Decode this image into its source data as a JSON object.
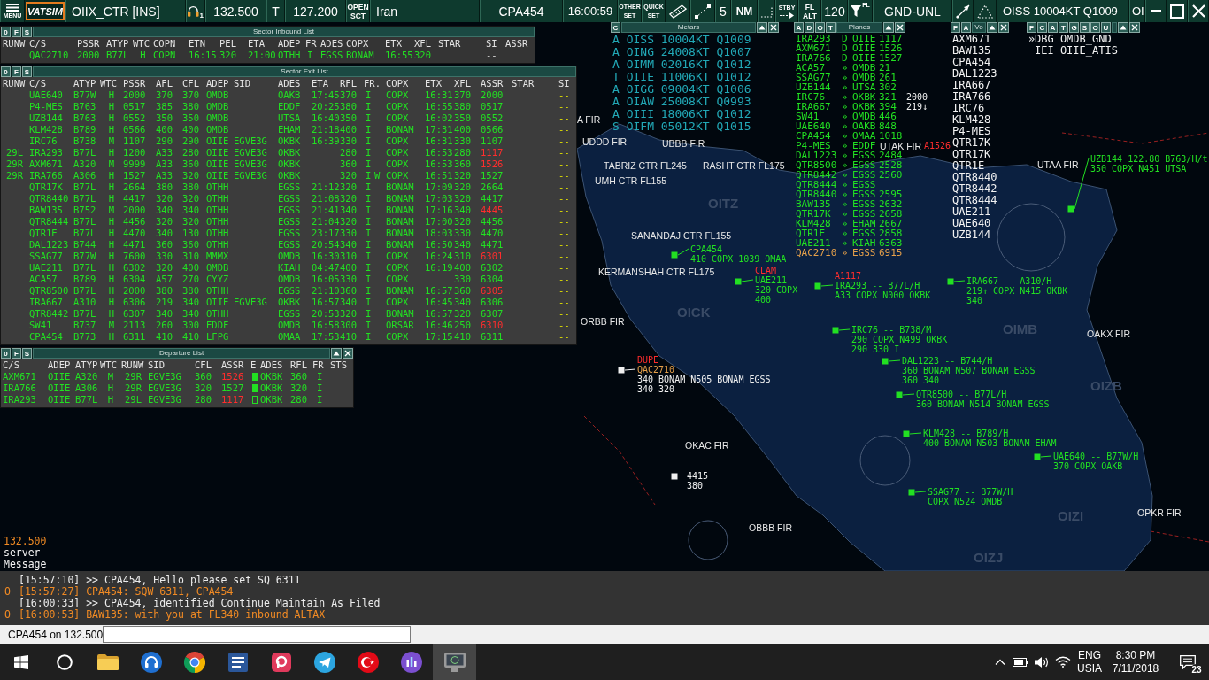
{
  "toolbar": {
    "menu_label": "MENU",
    "logo": "VATSIM",
    "position": "OIIX_CTR [INS]",
    "headset_count": "1",
    "primary_frequency": "132.500",
    "atis_letter": "T",
    "secondary_frequency": "127.200",
    "open_sector": [
      "OPEN",
      "SCT"
    ],
    "sector_file": "Iran",
    "selected_aircraft": "CPA454",
    "clock": "16:00:59",
    "other_set": [
      "OTHER",
      "SET"
    ],
    "quick_set": [
      "QUICK",
      "SET"
    ],
    "range": "5",
    "unit": "NM",
    "standby": "STBY",
    "altitude_mode": [
      "FL",
      "ALT"
    ],
    "transition_level": "120",
    "filter_label": "FL",
    "altitude_filter": "GND-UNL",
    "metar": "OISS 10004KT Q1009",
    "metar_cut": "OI"
  },
  "inbound_list": {
    "title": "Sector Inbound List",
    "buttons": [
      "0",
      "F",
      "S"
    ],
    "columns": [
      "RUNW",
      "C/S",
      "PSSR",
      "ATYP",
      "WTC",
      "COPN",
      "ETN",
      "PEL",
      "ETA",
      "ADEP",
      "FR",
      "ADES",
      "COPX",
      "ETX",
      "XFL",
      "STAR",
      "SI",
      "ASSR"
    ],
    "rows": [
      {
        "cs": "QAC2710",
        "pssr": "2000",
        "atyp": "B77L",
        "wtc": "H",
        "copn": "COPN",
        "etn": "16:15",
        "pel": "320",
        "eta": "21:00",
        "adep": "OTHH",
        "fr": "I",
        "ades": "EGSS",
        "copx": "BONAM",
        "etx": "16:55",
        "xfl": "320",
        "si": "--"
      }
    ]
  },
  "exit_list": {
    "title": "Sector Exit List",
    "buttons": [
      "0",
      "F",
      "S"
    ],
    "columns": [
      "RUNW",
      "C/S",
      "ATYP",
      "WTC",
      "PSSR",
      "AFL",
      "CFL",
      "ADEP",
      "SID",
      "ADES",
      "ETA",
      "RFL",
      "FR.",
      "COPX",
      "ETX",
      "XFL",
      "ASSR",
      "STAR",
      "SI"
    ],
    "rows": [
      {
        "cs": "UAE640",
        "atyp": "B77W",
        "wtc": "H",
        "pssr": "2000",
        "afl": "370",
        "cfl": "370",
        "adep": "OMDB",
        "ades": "OAKB",
        "eta": "17:45",
        "rfl": "370",
        "fr": "I",
        "copx": "COPX",
        "etx": "16:31",
        "xfl": "370",
        "assr": "2000",
        "assr_mismatch": false,
        "si": "--"
      },
      {
        "cs": "P4-MES",
        "atyp": "B763",
        "wtc": "H",
        "pssr": "0517",
        "afl": "385",
        "cfl": "380",
        "adep": "OMDB",
        "ades": "EDDF",
        "eta": "20:25",
        "rfl": "380",
        "fr": "I",
        "copx": "COPX",
        "etx": "16:55",
        "xfl": "380",
        "assr": "0517",
        "assr_mismatch": false,
        "si": "--"
      },
      {
        "cs": "UZB144",
        "atyp": "B763",
        "wtc": "H",
        "pssr": "0552",
        "afl": "350",
        "cfl": "350",
        "adep": "OMDB",
        "ades": "UTSA",
        "eta": "16:40",
        "rfl": "350",
        "fr": "I",
        "copx": "COPX",
        "etx": "16:02",
        "xfl": "350",
        "assr": "0552",
        "assr_mismatch": false,
        "si": "--"
      },
      {
        "cs": "KLM428",
        "atyp": "B789",
        "wtc": "H",
        "pssr": "0566",
        "afl": "400",
        "cfl": "400",
        "adep": "OMDB",
        "ades": "EHAM",
        "eta": "21:18",
        "rfl": "400",
        "fr": "I",
        "copx": "BONAM",
        "etx": "17:31",
        "xfl": "400",
        "assr": "0566",
        "assr_mismatch": false,
        "si": "--"
      },
      {
        "cs": "IRC76",
        "atyp": "B738",
        "wtc": "M",
        "pssr": "1107",
        "afl": "290",
        "cfl": "290",
        "adep": "OIIE",
        "sid": "EGVE3G",
        "ades": "OKBK",
        "eta": "16:39",
        "rfl": "330",
        "fr": "I",
        "copx": "COPX",
        "etx": "16:31",
        "xfl": "330",
        "assr": "1107",
        "assr_mismatch": false,
        "si": "--"
      },
      {
        "runw": "29L",
        "cs": "IRA293",
        "atyp": "B77L",
        "wtc": "H",
        "pssr": "1200",
        "afl": "A33",
        "cfl": "280",
        "adep": "OIIE",
        "sid": "EGVE3G",
        "ades": "OKBK",
        "rfl": "280",
        "fr": "I",
        "copx": "COPX",
        "etx": "16:53",
        "xfl": "280",
        "assr": "1117",
        "assr_mismatch": true,
        "si": "--"
      },
      {
        "runw": "29R",
        "cs": "AXM671",
        "atyp": "A320",
        "wtc": "M",
        "pssr": "9999",
        "afl": "A33",
        "cfl": "360",
        "adep": "OIIE",
        "sid": "EGVE3G",
        "ades": "OKBK",
        "rfl": "360",
        "fr": "I",
        "copx": "COPX",
        "etx": "16:53",
        "xfl": "360",
        "assr": "1526",
        "assr_mismatch": true,
        "si": "--"
      },
      {
        "runw": "29R",
        "cs": "IRA766",
        "atyp": "A306",
        "wtc": "H",
        "pssr": "1527",
        "afl": "A33",
        "cfl": "320",
        "adep": "OIIE",
        "sid": "EGVE3G",
        "ades": "OKBK",
        "rfl": "320",
        "fr": "I",
        "flag": "W",
        "copx": "COPX",
        "etx": "16:51",
        "xfl": "320",
        "assr": "1527",
        "assr_mismatch": false,
        "si": "--"
      },
      {
        "cs": "QTR17K",
        "atyp": "B77L",
        "wtc": "H",
        "pssr": "2664",
        "afl": "380",
        "cfl": "380",
        "adep": "OTHH",
        "ades": "EGSS",
        "eta": "21:12",
        "rfl": "320",
        "fr": "I",
        "copx": "BONAM",
        "etx": "17:09",
        "xfl": "320",
        "assr": "2664",
        "assr_mismatch": false,
        "si": "--"
      },
      {
        "cs": "QTR8440",
        "atyp": "B77L",
        "wtc": "H",
        "pssr": "4417",
        "afl": "320",
        "cfl": "320",
        "adep": "OTHH",
        "ades": "EGSS",
        "eta": "21:08",
        "rfl": "320",
        "fr": "I",
        "copx": "BONAM",
        "etx": "17:03",
        "xfl": "320",
        "assr": "4417",
        "assr_mismatch": false,
        "si": "--"
      },
      {
        "cs": "BAW135",
        "atyp": "B752",
        "wtc": "M",
        "pssr": "2000",
        "afl": "340",
        "cfl": "340",
        "adep": "OTHH",
        "ades": "EGSS",
        "eta": "21:41",
        "rfl": "340",
        "fr": "I",
        "copx": "BONAM",
        "etx": "17:16",
        "xfl": "340",
        "assr": "4445",
        "assr_mismatch": true,
        "si": "--"
      },
      {
        "cs": "QTR8444",
        "atyp": "B77L",
        "wtc": "H",
        "pssr": "4456",
        "afl": "320",
        "cfl": "320",
        "adep": "OTHH",
        "ades": "EGSS",
        "eta": "21:04",
        "rfl": "320",
        "fr": "I",
        "copx": "BONAM",
        "etx": "17:00",
        "xfl": "320",
        "assr": "4456",
        "assr_mismatch": false,
        "si": "--"
      },
      {
        "cs": "QTR1E",
        "atyp": "B77L",
        "wtc": "H",
        "pssr": "4470",
        "afl": "340",
        "cfl": "130",
        "adep": "OTHH",
        "ades": "EGSS",
        "eta": "23:17",
        "rfl": "330",
        "fr": "I",
        "copx": "BONAM",
        "etx": "18:03",
        "xfl": "330",
        "assr": "4470",
        "assr_mismatch": false,
        "si": "--"
      },
      {
        "cs": "DAL1223",
        "atyp": "B744",
        "wtc": "H",
        "pssr": "4471",
        "afl": "360",
        "cfl": "360",
        "adep": "OTHH",
        "ades": "EGSS",
        "eta": "20:54",
        "rfl": "340",
        "fr": "I",
        "copx": "BONAM",
        "etx": "16:50",
        "xfl": "340",
        "assr": "4471",
        "assr_mismatch": false,
        "si": "--"
      },
      {
        "cs": "SSAG77",
        "atyp": "B77W",
        "wtc": "H",
        "pssr": "7600",
        "afl": "330",
        "cfl": "310",
        "adep": "MMMX",
        "ades": "OMDB",
        "eta": "16:30",
        "rfl": "310",
        "fr": "I",
        "copx": "COPX",
        "etx": "16:24",
        "xfl": "310",
        "assr": "6301",
        "assr_mismatch": true,
        "si": "--"
      },
      {
        "cs": "UAE211",
        "atyp": "B77L",
        "wtc": "H",
        "pssr": "6302",
        "afl": "320",
        "cfl": "400",
        "adep": "OMDB",
        "ades": "KIAH",
        "eta": "04:47",
        "rfl": "400",
        "fr": "I",
        "copx": "COPX",
        "etx": "16:19",
        "xfl": "400",
        "assr": "6302",
        "assr_mismatch": false,
        "si": "--"
      },
      {
        "cs": "ACA57",
        "atyp": "B789",
        "wtc": "H",
        "pssr": "6304",
        "afl": "A57",
        "cfl": "270",
        "adep": "CYYZ",
        "ades": "OMDB",
        "eta": "16:05",
        "rfl": "330",
        "fr": "I",
        "copx": "COPX",
        "xfl": "330",
        "assr": "6304",
        "assr_mismatch": false,
        "si": "--"
      },
      {
        "cs": "QTR8500",
        "atyp": "B77L",
        "wtc": "H",
        "pssr": "2000",
        "afl": "380",
        "cfl": "380",
        "adep": "OTHH",
        "ades": "EGSS",
        "eta": "21:10",
        "rfl": "360",
        "fr": "I",
        "copx": "BONAM",
        "etx": "16:57",
        "xfl": "360",
        "assr": "6305",
        "assr_mismatch": true,
        "si": "--"
      },
      {
        "cs": "IRA667",
        "atyp": "A310",
        "wtc": "H",
        "pssr": "6306",
        "afl": "219",
        "cfl": "340",
        "adep": "OIIE",
        "sid": "EGVE3G",
        "ades": "OKBK",
        "eta": "16:57",
        "rfl": "340",
        "fr": "I",
        "copx": "COPX",
        "etx": "16:45",
        "xfl": "340",
        "assr": "6306",
        "assr_mismatch": false,
        "si": "--"
      },
      {
        "cs": "QTR8442",
        "atyp": "B77L",
        "wtc": "H",
        "pssr": "6307",
        "afl": "340",
        "cfl": "340",
        "adep": "OTHH",
        "ades": "EGSS",
        "eta": "20:53",
        "rfl": "320",
        "fr": "I",
        "copx": "BONAM",
        "etx": "16:57",
        "xfl": "320",
        "assr": "6307",
        "assr_mismatch": false,
        "si": "--"
      },
      {
        "cs": "SW41",
        "atyp": "B737",
        "wtc": "M",
        "pssr": "2113",
        "afl": "260",
        "cfl": "300",
        "adep": "EDDF",
        "ades": "OMDB",
        "eta": "16:58",
        "rfl": "300",
        "fr": "I",
        "copx": "ORSAR",
        "etx": "16:46",
        "xfl": "250",
        "assr": "6310",
        "assr_mismatch": true,
        "si": "--"
      },
      {
        "cs": "CPA454",
        "atyp": "B773",
        "wtc": "H",
        "pssr": "6311",
        "afl": "410",
        "cfl": "410",
        "adep": "LFPG",
        "ades": "OMAA",
        "eta": "17:53",
        "rfl": "410",
        "fr": "I",
        "copx": "COPX",
        "etx": "17:15",
        "xfl": "410",
        "assr": "6311",
        "assr_mismatch": false,
        "si": "--"
      }
    ]
  },
  "departure_list": {
    "title": "Departure List",
    "buttons": [
      "0",
      "F",
      "S"
    ],
    "columns": [
      "C/S",
      "ADEP",
      "ATYP",
      "WTC",
      "RUNW",
      "SID",
      "CFL",
      "ASSR",
      "E",
      "ADES",
      "RFL",
      "FR",
      "STS"
    ],
    "rows": [
      {
        "cs": "AXM671",
        "adep": "OIIE",
        "atyp": "A320",
        "wtc": "M",
        "runw": "29R",
        "sid": "EGVE3G",
        "cfl": "360",
        "assr": "1526",
        "assr_mismatch": true,
        "e_flag": true,
        "ades": "OKBK",
        "rfl": "360",
        "fr": "I"
      },
      {
        "cs": "IRA766",
        "adep": "OIIE",
        "atyp": "A306",
        "wtc": "H",
        "runw": "29R",
        "sid": "EGVE3G",
        "cfl": "320",
        "assr": "1527",
        "assr_mismatch": false,
        "e_flag": true,
        "ades": "OKBK",
        "rfl": "320",
        "fr": "I"
      },
      {
        "cs": "IRA293",
        "adep": "OIIE",
        "atyp": "B77L",
        "wtc": "H",
        "runw": "29L",
        "sid": "EGVE3G",
        "cfl": "280",
        "assr": "1117",
        "assr_mismatch": true,
        "e_flag": false,
        "ades": "OKBK",
        "rfl": "280",
        "fr": "I"
      }
    ]
  },
  "metars": {
    "buttons": [
      "C"
    ],
    "title": "Metars",
    "lines": [
      "A OISS 10004KT Q1009",
      "A OING 24008KT Q1007",
      "A OIMM 02016KT Q1012",
      "T OIIE 11006KT Q1012",
      "A OIGG 09004KT Q1006",
      "A OIAW 25008KT Q0993",
      "A OIII 18006KT Q1012",
      "S OIFM 05012KT Q1015"
    ]
  },
  "planes": {
    "buttons": [
      "A",
      "D",
      "O",
      "T"
    ],
    "title": "Planes",
    "rows": [
      {
        "callsign": "IRA293",
        "marker": "D",
        "airport": "OIIE",
        "value": "1117",
        "color": "#22e022"
      },
      {
        "callsign": "AXM671",
        "marker": "D",
        "airport": "OIIE",
        "value": "1526",
        "color": "#22e022"
      },
      {
        "callsign": "IRA766",
        "marker": "D",
        "airport": "OIIE",
        "value": "1527",
        "color": "#22e022"
      },
      {
        "callsign": "ACA57",
        "marker": "»",
        "airport": "OMDB",
        "value": "21",
        "color": "#22e022"
      },
      {
        "callsign": "SSAG77",
        "marker": "»",
        "airport": "OMDB",
        "value": "261",
        "color": "#22e022"
      },
      {
        "callsign": "UZB144",
        "marker": "»",
        "airport": "UTSA",
        "value": "302",
        "color": "#22e022"
      },
      {
        "callsign": "IRC76",
        "marker": "»",
        "airport": "OKBK",
        "value": "321",
        "color": "#22e022"
      },
      {
        "callsign": "IRA667",
        "marker": "»",
        "airport": "OKBK",
        "value": "394",
        "color": "#22e022"
      },
      {
        "callsign": "SW41",
        "marker": "»",
        "airport": "OMDB",
        "value": "446",
        "color": "#22e022"
      },
      {
        "callsign": "UAE640",
        "marker": "»",
        "airport": "OAKB",
        "value": "848",
        "color": "#22e022"
      },
      {
        "callsign": "CPA454",
        "marker": "»",
        "airport": "OMAA",
        "value": "1018",
        "color": "#22e022"
      },
      {
        "callsign": "P4-MES",
        "marker": "»",
        "airport": "EDDF",
        "color": "#22e022"
      },
      {
        "callsign": "DAL1223",
        "marker": "»",
        "airport": "EGSS",
        "value": "2484",
        "color": "#22e022"
      },
      {
        "callsign": "QTR8500",
        "marker": "»",
        "airport": "EGSS",
        "value": "2528",
        "color": "#22e022"
      },
      {
        "callsign": "QTR8442",
        "marker": "»",
        "airport": "EGSS",
        "value": "2560",
        "color": "#22e022"
      },
      {
        "callsign": "QTR8444",
        "marker": "»",
        "airport": "EGSS",
        "color": "#22e022"
      },
      {
        "callsign": "QTR8440",
        "marker": "»",
        "airport": "EGSS",
        "value": "2595",
        "color": "#22e022"
      },
      {
        "callsign": "BAW135",
        "marker": "»",
        "airport": "EGSS",
        "value": "2632",
        "color": "#22e022"
      },
      {
        "callsign": "QTR17K",
        "marker": "»",
        "airport": "EGSS",
        "value": "2658",
        "color": "#22e022"
      },
      {
        "callsign": "KLM428",
        "marker": "»",
        "airport": "EHAM",
        "value": "2667",
        "color": "#22e022"
      },
      {
        "callsign": "QTR1E",
        "marker": "»",
        "airport": "EGSS",
        "value": "2858",
        "color": "#22e022"
      },
      {
        "callsign": "UAE211",
        "marker": "»",
        "airport": "KIAH",
        "value": "6363",
        "color": "#22e022"
      },
      {
        "callsign": "QAC2710",
        "marker": "»",
        "airport": "EGSS",
        "value": "6915",
        "color": "#e6a04a"
      }
    ]
  },
  "voice_list": {
    "buttons": [
      "F",
      "A"
    ],
    "title": "Vo",
    "callsigns": [
      "AXM671",
      "BAW135",
      "CPA454",
      "DAL1223",
      "IRA667",
      "IRA766",
      "IRC76",
      "KLM428",
      "P4-MES",
      "QTR17K",
      "QTR17K",
      "QTR1E",
      "QTR8440",
      "QTR8442",
      "QTR8444",
      "UAE211",
      "UAE640",
      "UZB144"
    ]
  },
  "controller_list": {
    "buttons": [
      "F",
      "C",
      "A",
      "T",
      "G",
      "S",
      "O",
      "U"
    ],
    "rows": [
      {
        "marker": "»",
        "text": "DBG OMDB_GND"
      },
      {
        "text": "IEI OIIE_ATIS"
      }
    ]
  },
  "scope": {
    "readouts": [
      {
        "lines": [
          "2000",
          "219↓"
        ]
      },
      {
        "lines": [
          "4415",
          "380"
        ]
      }
    ],
    "fir_labels": [
      "A FIR",
      "UDDD FIR",
      "UBBB FIR",
      "UTAK FIR",
      "UTAA FIR",
      "ORBB FIR",
      "OAKX FIR",
      "OKAC FIR",
      "OPKR FIR",
      "OBBB FIR"
    ],
    "alerts": [
      "A1526"
    ],
    "sector_labels": [
      "TABRIZ CTR FL245",
      "RASHT CTR FL175",
      "UMH CTR FL155",
      "SANANDAJ CTR FL155",
      "KERMANSHAH CTR FL175"
    ],
    "airport_labels": [
      "OITZ",
      "OICK",
      "OIMB",
      "OIZB",
      "OIZI",
      "OIZJ"
    ],
    "tags": [
      {
        "kind": "tracked",
        "lines": [
          "UZB144 122.80 B763/H/t",
          "350 COPX N451 UTSA"
        ]
      },
      {
        "kind": "tracked",
        "lines": [
          "CPA454",
          "410 COPX 1039 OMAA"
        ]
      },
      {
        "kind": "tracked",
        "alert": "CLAM",
        "lines": [
          "UAE211",
          "320 COPX",
          "400"
        ]
      },
      {
        "kind": "tracked",
        "alert": "A1117",
        "lines": [
          "IRA293 -- B77L/H",
          "A33 COPX N000 OKBK"
        ]
      },
      {
        "kind": "tracked",
        "lines": [
          "IRA667 -- A310/H",
          "219↑ COPX N415 OKBK",
          "340"
        ]
      },
      {
        "kind": "tracked",
        "lines": [
          "IRC76 -- B738/M",
          "290 COPX N499 OKBK",
          "290 330 I"
        ]
      },
      {
        "kind": "untracked",
        "alert": "DUPE",
        "lines": [
          "QAC2710",
          "340 BONAM N505 BONAM EGSS",
          "340 320"
        ]
      },
      {
        "kind": "tracked",
        "lines": [
          "DAL1223 -- B744/H",
          "360 BONAM N507 BONAM EGSS",
          "360 340"
        ]
      },
      {
        "kind": "tracked",
        "lines": [
          "QTR8500 -- B77L/H",
          "360 BONAM N514 BONAM EGSS"
        ]
      },
      {
        "kind": "tracked",
        "lines": [
          "KLM428 -- B789/H",
          "400 BONAM N503 BONAM EHAM"
        ]
      },
      {
        "kind": "tracked",
        "lines": [
          "UAE640 -- B77W/H",
          "370 COPX OAKB"
        ]
      },
      {
        "kind": "tracked",
        "lines": [
          "SSAG77 -- B77W/H",
          "COPX N524 OMDB"
        ]
      }
    ]
  },
  "chat": {
    "tabs": [
      {
        "label": "132.500",
        "highlighted": true
      },
      {
        "label": "server",
        "highlighted": false
      },
      {
        "label": "Message",
        "highlighted": false
      }
    ],
    "messages": [
      {
        "kind": "sent",
        "time": "[15:57:10]",
        "text": ">> CPA454, Hello please set SQ 6311"
      },
      {
        "kind": "received",
        "marker": "O",
        "time": "[15:57:27]",
        "text": "CPA454: SQW 6311, CPA454"
      },
      {
        "kind": "sent",
        "time": "[16:00:33]",
        "text": ">> CPA454, identified Continue Maintain As Filed"
      },
      {
        "kind": "received",
        "marker": "O",
        "time": "[16:00:53]",
        "text": "BAW135: with you at FL340 inbound ALTAX"
      }
    ]
  },
  "command_line": {
    "label": "CPA454 on 132.500"
  },
  "taskbar": {
    "apps": [
      {
        "kind": "start",
        "selected": false
      },
      {
        "kind": "search",
        "selected": false
      },
      {
        "kind": "folder",
        "selected": false
      },
      {
        "kind": "headset",
        "selected": false
      },
      {
        "kind": "browser",
        "selected": false
      },
      {
        "kind": "document",
        "selected": false
      },
      {
        "kind": "tile",
        "selected": false
      },
      {
        "kind": "messenger",
        "selected": false
      },
      {
        "kind": "flag",
        "selected": false
      },
      {
        "kind": "media",
        "selected": false
      },
      {
        "kind": "radar",
        "selected": true
      }
    ],
    "language": "ENG",
    "keyboard": "USIA",
    "time": "8:30 PM",
    "date": "7/11/2018",
    "notifications": "23"
  }
}
